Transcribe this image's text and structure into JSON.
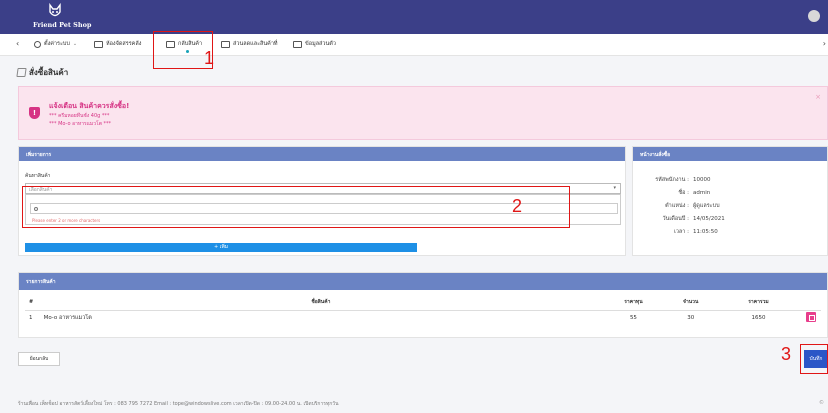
{
  "header": {
    "logo_text": "Friend Pet Shop"
  },
  "nav": {
    "items": [
      {
        "label": "ตั้งค่าระบบ",
        "has_caret": true
      },
      {
        "label": "ห้องจัดสรรคลัง"
      },
      {
        "label": "กลับสินค้า"
      },
      {
        "label": "ส่วนลดและสินค้าที่"
      },
      {
        "label": "ข้อมูลส่วนตัว"
      }
    ],
    "active_index": 2
  },
  "page": {
    "title": "สั่งซื้อสินค้า"
  },
  "alert": {
    "title": "แจ้งเตือน สินค้าควรสั่งซื้อ!",
    "lines": [
      "*** ครีมหอยทึนชั่ง 40g ***",
      "*** Mo-o อาหารแมวโต ***"
    ],
    "close": "×"
  },
  "add_panel": {
    "header": "เพิ่มรายการ",
    "field_label": "ค้นหาสินค้า",
    "select_placeholder": "เลือกสินค้า",
    "hint": "Please enter 2 or more characters",
    "add_button": "+ เพิ่ม"
  },
  "order_panel": {
    "header": "หน้างานสั่งซื้อ",
    "rows": [
      {
        "label": "รหัสพนักงาน :",
        "value": "10000"
      },
      {
        "label": "ชื่อ :",
        "value": "admin"
      },
      {
        "label": "ตำแหน่ง :",
        "value": "ผู้ดูแลระบบ"
      },
      {
        "label": "วันเดือนปี :",
        "value": "14/05/2021"
      },
      {
        "label": "เวลา :",
        "value": "11:05:50"
      }
    ]
  },
  "items_panel": {
    "header": "รายการสินค้า",
    "columns": [
      "#",
      "ชื่อสินค้า",
      "ราคาทุน",
      "จำนวน",
      "ราคารวม"
    ],
    "rows": [
      {
        "no": "1",
        "name": "Mo-o อาหารแมวโต",
        "cost": "55",
        "qty": "30",
        "total": "1650"
      }
    ]
  },
  "buttons": {
    "back": "ย้อนกลับ",
    "save": "บันทึก"
  },
  "footer": {
    "text": "ร้านเพื่อน เพ็ทช็อป อาหารสัตว์เลี้ยงใหม่ โทร : 083 795 7272 Email : tope@windowslive.com เวลาเปิด-ปิด : 09.00-24.00 น. เปิดบริการทุกวัน",
    "end": "©"
  },
  "annotations": [
    {
      "label": "1",
      "color": "#e01616"
    },
    {
      "label": "2",
      "color": "#e01616"
    },
    {
      "label": "3",
      "color": "#e01616"
    }
  ]
}
